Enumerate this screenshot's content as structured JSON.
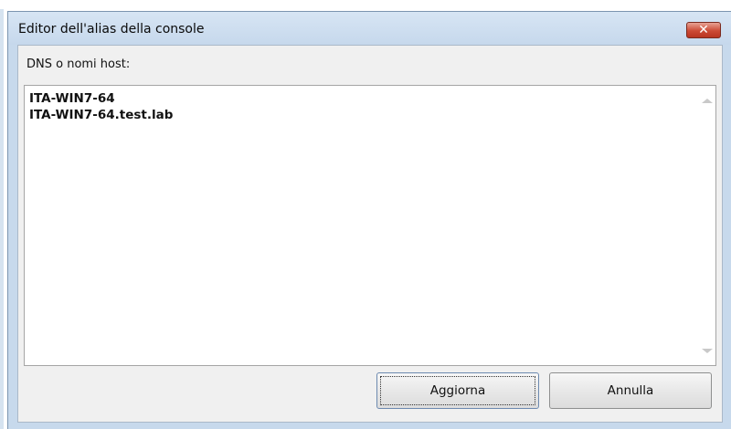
{
  "dialog": {
    "title": "Editor dell'alias della console",
    "close_glyph": "✕"
  },
  "form": {
    "label": "DNS o nomi host:",
    "hosts": [
      "ITA-WIN7-64",
      "ITA-WIN7-64.test.lab"
    ]
  },
  "buttons": {
    "update_label": "Aggiorna",
    "cancel_label": "Annulla"
  },
  "icons": {
    "close": "close-icon",
    "scroll_up": "scroll-up-arrow-icon",
    "scroll_down": "scroll-down-arrow-icon"
  },
  "colors": {
    "window_frame": "#c7d9ec",
    "close_button": "#cc4a35",
    "client_background": "#f0f0f0"
  }
}
